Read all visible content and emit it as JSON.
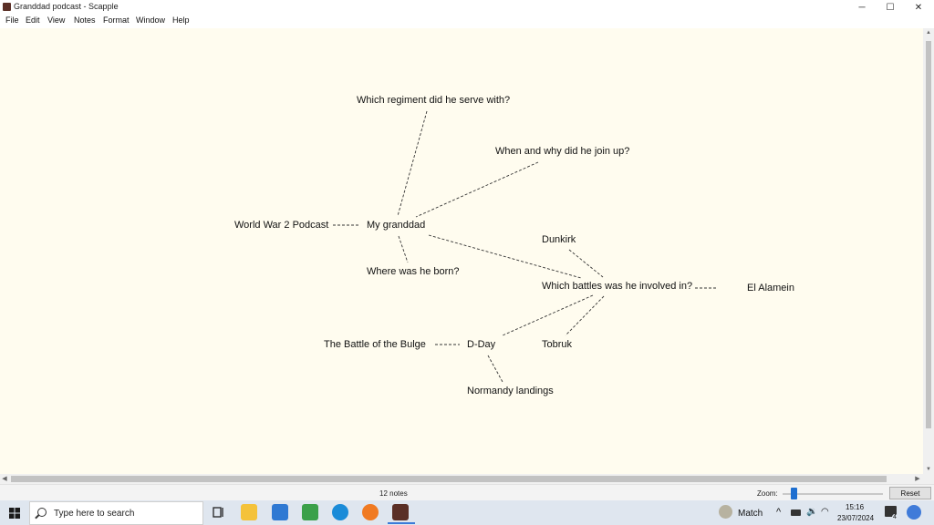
{
  "window": {
    "title": "Granddad podcast - Scapple",
    "controls": {
      "minimize": "─",
      "maximize": "☐",
      "close": "✕"
    }
  },
  "menu": [
    "File",
    "Edit",
    "View",
    "Notes",
    "Format",
    "Window",
    "Help"
  ],
  "notes": {
    "regiment": "Which regiment did he serve with?",
    "join_up": "When and why did he join up?",
    "ww2_podcast": "World War 2 Podcast",
    "granddad": "My granddad",
    "born": "Where was he born?",
    "dunkirk": "Dunkirk",
    "battles": "Which battles was he involved in?",
    "el_alamein": "El Alamein",
    "bulge": "The Battle of the Bulge",
    "dday": "D-Day",
    "tobruk": "Tobruk",
    "normandy": "Normandy landings"
  },
  "status": {
    "note_count": "12 notes",
    "zoom_label": "Zoom:",
    "reset_label": "Reset"
  },
  "taskbar": {
    "search_placeholder": "Type here to search",
    "weather_label": "Match",
    "time": "15:16",
    "date": "23/07/2024",
    "notification_count": "4",
    "accent_color": "#3b7bd8"
  },
  "canvas_color": "#fffcef"
}
